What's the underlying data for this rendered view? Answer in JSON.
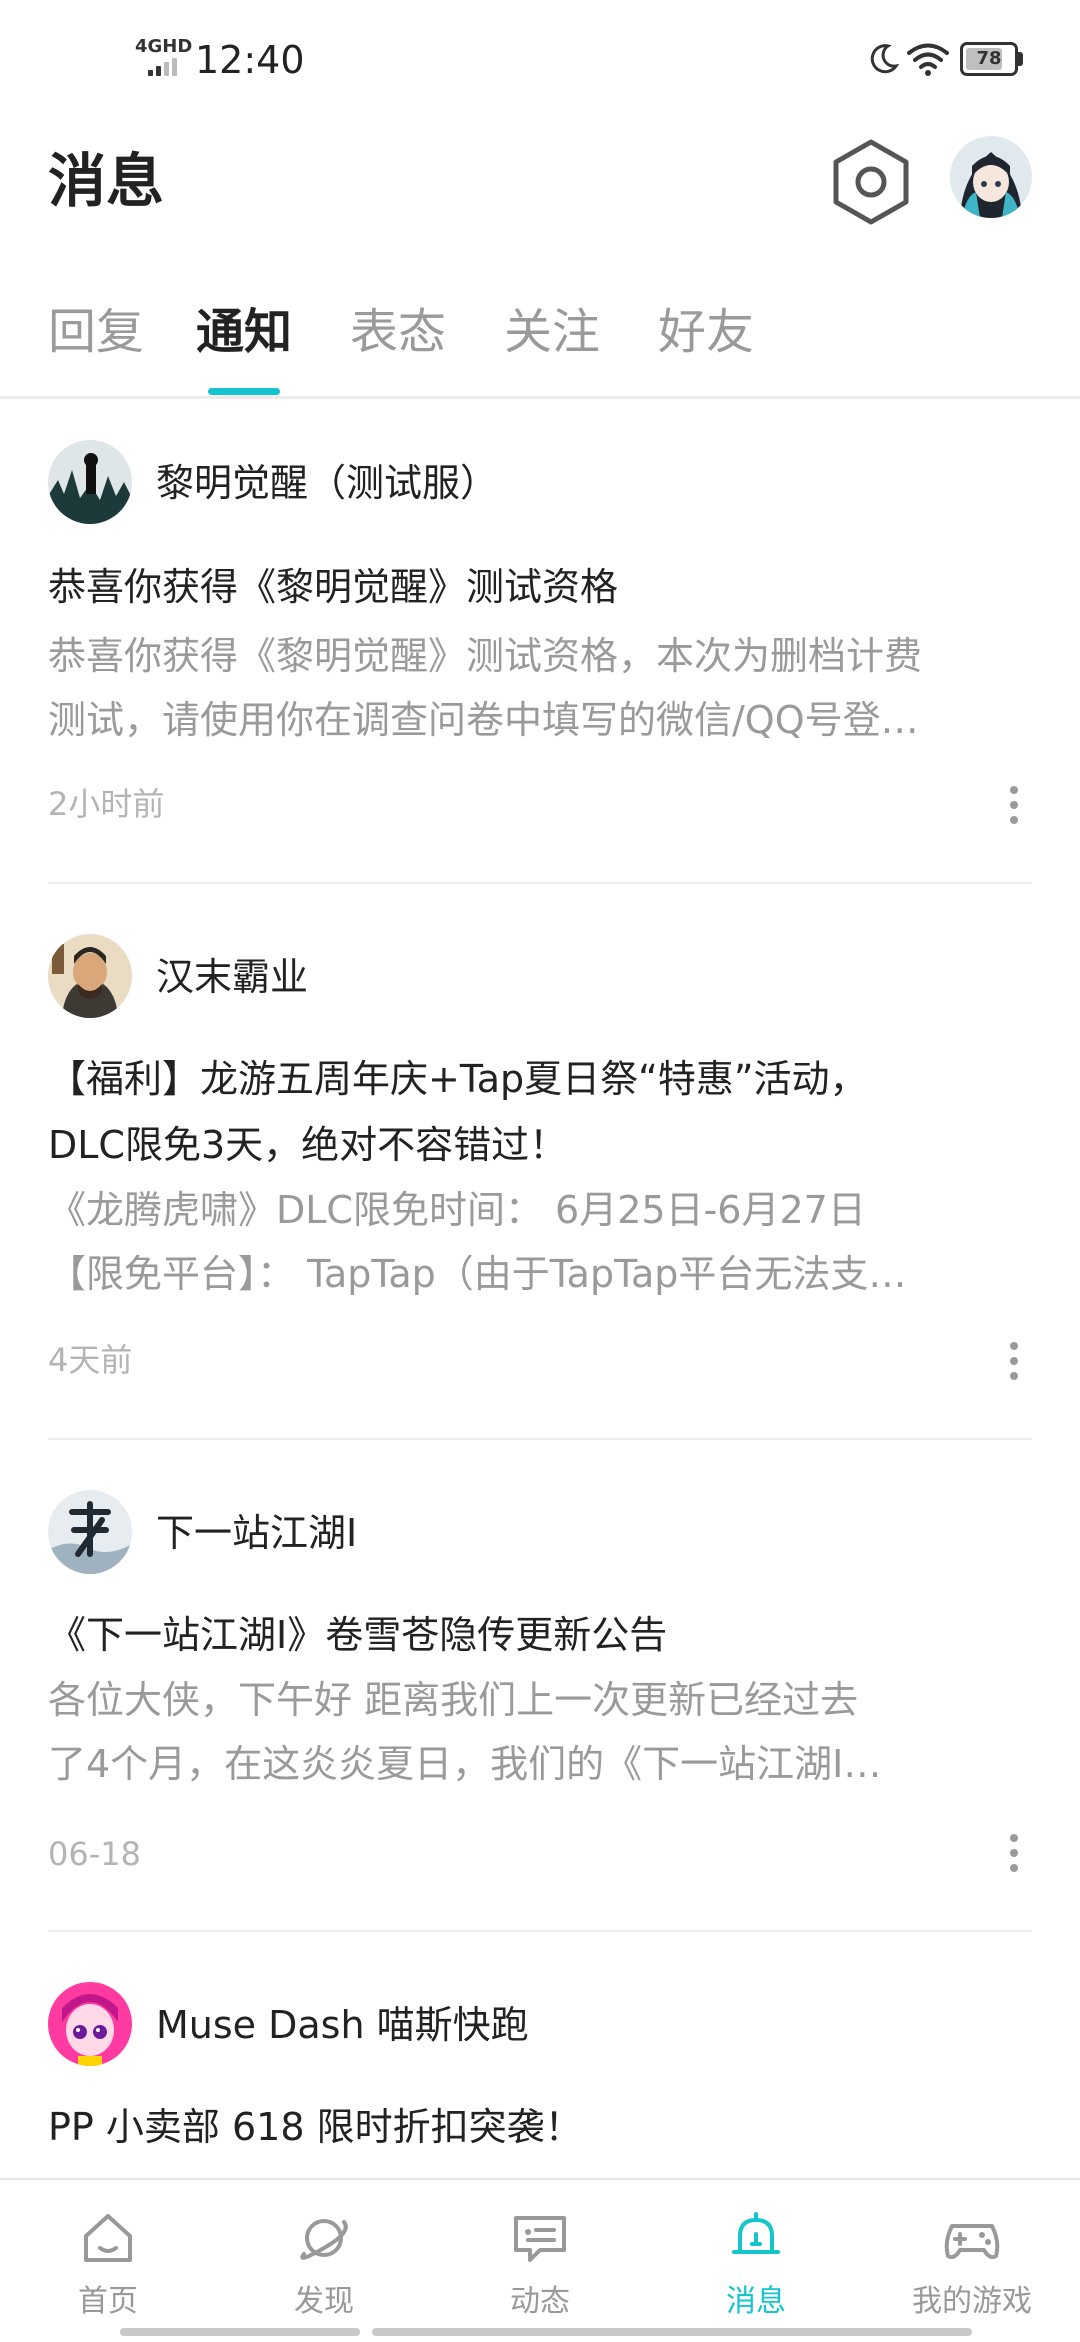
{
  "status_bar": {
    "network": "4GHD",
    "time": "12:40",
    "battery": "78",
    "battery_level": 0.78
  },
  "header": {
    "title": "消息",
    "settings_icon": "settings-hexagon-icon",
    "avatar_icon": "user-avatar"
  },
  "tabs": [
    {
      "label": "回复",
      "active": false
    },
    {
      "label": "通知",
      "active": true
    },
    {
      "label": "表态",
      "active": false
    },
    {
      "label": "关注",
      "active": false
    },
    {
      "label": "好友",
      "active": false
    }
  ],
  "notifications": [
    {
      "source": "黎明觉醒（测试服）",
      "title_lines": [
        "恭喜你获得《黎明觉醒》测试资格"
      ],
      "body_lines": [
        "恭喜你获得《黎明觉醒》测试资格，本次为删档计费",
        "测试，请使用你在调查问卷中填写的微信/QQ号登…"
      ],
      "time": "2小时前"
    },
    {
      "source": "汉末霸业",
      "title_lines": [
        "【福利】龙游五周年庆+Tap夏日祭“特惠”活动，",
        "DLC限免3天，绝对不容错过！"
      ],
      "body_lines": [
        "《龙腾虎啸》DLC限免时间：  6月25日-6月27日",
        "【限免平台】：  TapTap（由于TapTap平台无法支…"
      ],
      "time": "4天前"
    },
    {
      "source": "下一站江湖Ⅰ",
      "title_lines": [
        "《下一站江湖Ⅰ》卷雪苍隐传更新公告"
      ],
      "body_lines": [
        "各位大侠，下午好        距离我们上一次更新已经过去",
        "了4个月，在这炎炎夏日，我们的《下一站江湖Ⅰ…"
      ],
      "time": "06-18"
    },
    {
      "source": "Muse Dash 喵斯快跑",
      "title_lines": [
        "PP 小卖部 618 限时折扣突袭！"
      ],
      "body_lines": [],
      "time": ""
    }
  ],
  "bottom_nav": [
    {
      "label": "首页",
      "icon": "home-icon",
      "active": false
    },
    {
      "label": "发现",
      "icon": "planet-icon",
      "active": false
    },
    {
      "label": "动态",
      "icon": "chat-bubble-icon",
      "active": false
    },
    {
      "label": "消息",
      "icon": "bell-icon",
      "active": true
    },
    {
      "label": "我的游戏",
      "icon": "gamepad-icon",
      "active": false
    }
  ],
  "colors": {
    "accent": "#15c5ce",
    "text": "#222222",
    "muted": "#9a9a9a"
  }
}
